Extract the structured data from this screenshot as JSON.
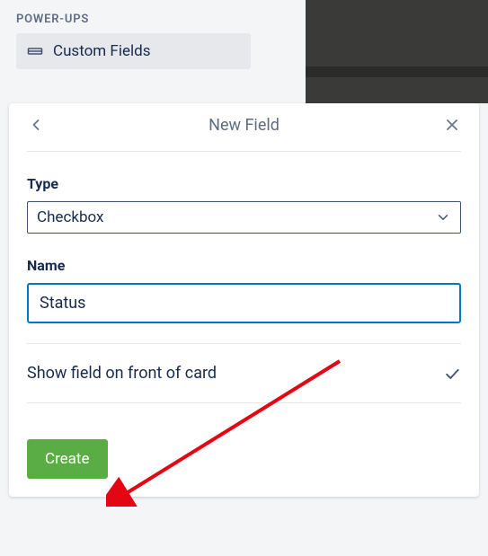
{
  "sidebar": {
    "section_heading": "POWER-UPS",
    "item": {
      "label": "Custom Fields",
      "icon": "custom-fields-icon"
    }
  },
  "popover": {
    "title": "New Field",
    "type": {
      "label": "Type",
      "selected": "Checkbox"
    },
    "name": {
      "label": "Name",
      "value": "Status"
    },
    "toggle": {
      "label": "Show field on front of card",
      "checked": true
    },
    "create_label": "Create"
  }
}
